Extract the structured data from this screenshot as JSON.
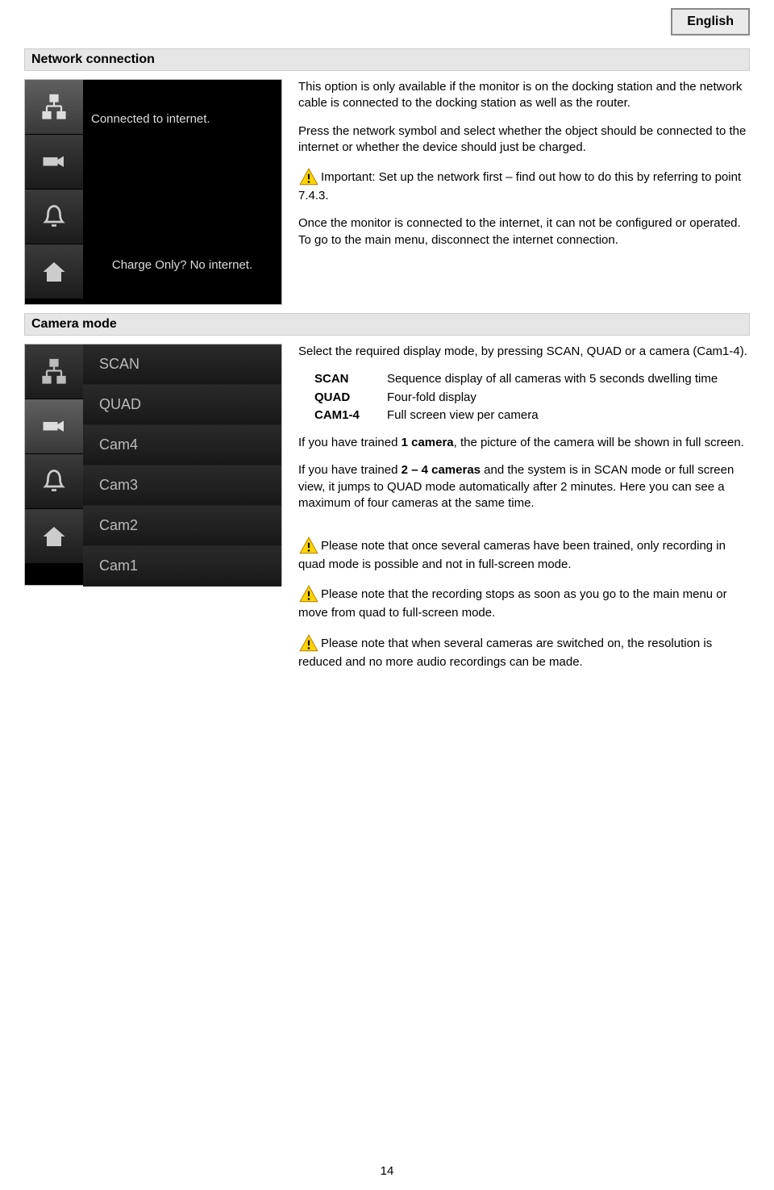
{
  "language_badge": "English",
  "page_number": "14",
  "sections": {
    "network": {
      "header": "Network connection",
      "screenshot": {
        "status_connected": "Connected to internet.",
        "status_charge": "Charge Only? No internet."
      },
      "para1": "This option is only available if the monitor is on the docking station and the network cable is connected to the docking station as well as the router.",
      "para2": "Press the network symbol and select whether the object should be connected to the internet or whether the device should just be charged.",
      "warning1": "Important: Set up the network first – find out how to do this by referring to point 7.4.3.",
      "para3": "Once the monitor is connected to the internet, it can not be configured or operated. To go to the main menu, disconnect the internet connection."
    },
    "camera": {
      "header": "Camera mode",
      "screenshot": {
        "items": [
          "SCAN",
          "QUAD",
          "Cam4",
          "Cam3",
          "Cam2",
          "Cam1"
        ]
      },
      "para1": "Select the required display mode, by pressing SCAN, QUAD or a camera (Cam1-4).",
      "defs": {
        "scan_term": "SCAN",
        "scan_desc": "Sequence display of all cameras with 5 seconds dwelling time",
        "quad_term": "QUAD",
        "quad_desc": "Four-fold display",
        "cam_term": "CAM1-4",
        "cam_desc": "Full screen view per camera"
      },
      "para2_a": "If you have trained ",
      "para2_b": "1 camera",
      "para2_c": ", the picture of the camera will be shown in full screen.",
      "para3_a": "If you have trained ",
      "para3_b": "2 – 4 cameras",
      "para3_c": " and the system is in SCAN mode or full screen view, it jumps to QUAD mode automatically after 2 minutes. Here you can see a maximum of four cameras at the same time.",
      "warning1": "Please note that once several cameras have been trained, only recording in quad mode is possible and not in full-screen mode.",
      "warning2": "Please note that the recording stops as soon as you go to the main menu or move from quad to full-screen mode.",
      "warning3": "Please note that when several cameras are switched on, the resolution is reduced and no more audio recordings can be made."
    }
  }
}
